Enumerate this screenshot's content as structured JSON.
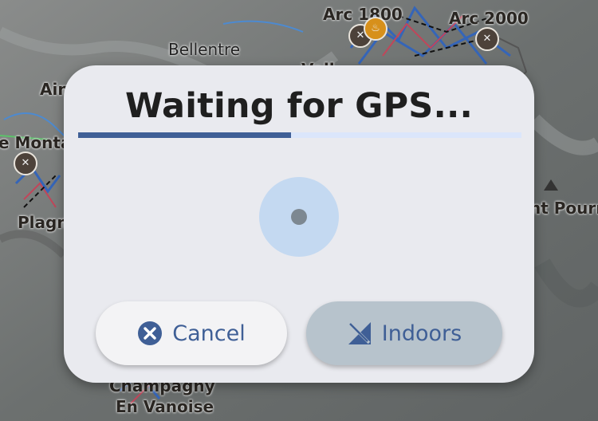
{
  "map": {
    "places": [
      {
        "label": "Arc 1800"
      },
      {
        "label": "Arc 2000"
      },
      {
        "label": "Bellentre"
      },
      {
        "label": "Ain"
      },
      {
        "label": "e Monta"
      },
      {
        "label": "Plagn"
      },
      {
        "label": "nt Pourri"
      },
      {
        "label": "Champagny"
      },
      {
        "label": "En Vanoise"
      },
      {
        "label": "Vall"
      }
    ],
    "icons": [
      "windmill-icon",
      "food-icon",
      "peak-icon"
    ]
  },
  "dialog": {
    "title": "Waiting for GPS...",
    "progress_fraction": 0.48,
    "cancel_label": "Cancel",
    "indoors_label": "Indoors",
    "colors": {
      "accent": "#3f5f96",
      "track": "#dbe6fb",
      "halo": "#c4d9f1",
      "background": "#e9eaef"
    }
  }
}
